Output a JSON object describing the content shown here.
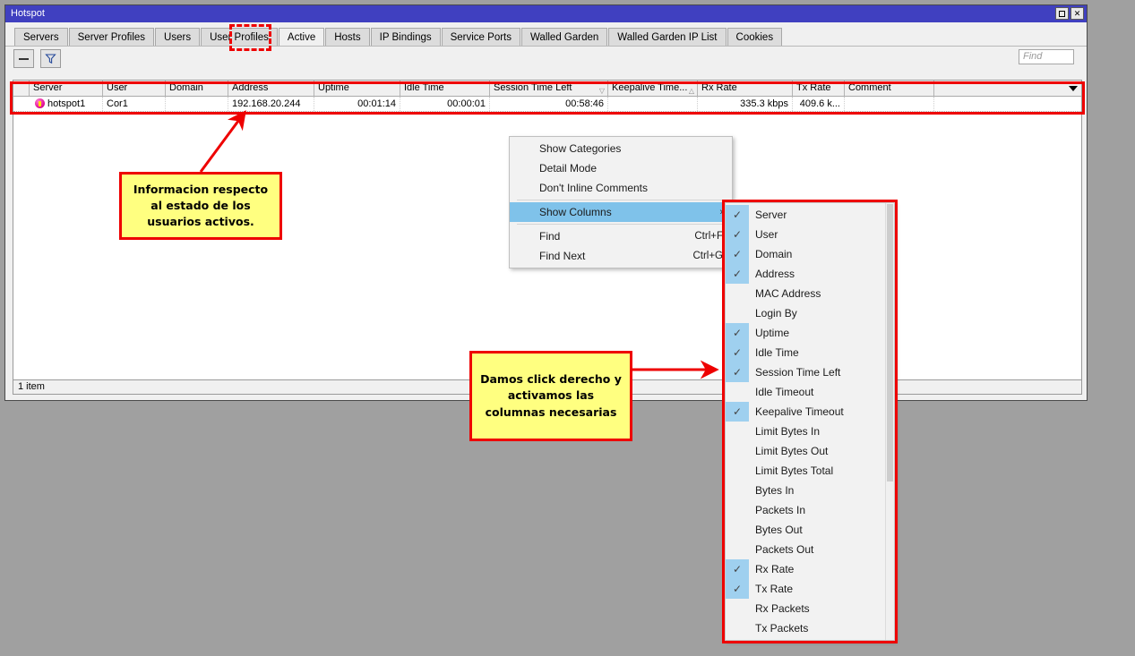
{
  "window": {
    "title": "Hotspot",
    "maximize_label": "maximize",
    "close_label": "✕"
  },
  "tabs": [
    {
      "label": "Servers",
      "active": false
    },
    {
      "label": "Server Profiles",
      "active": false
    },
    {
      "label": "Users",
      "active": false
    },
    {
      "label": "User Profiles",
      "active": false
    },
    {
      "label": "Active",
      "active": true
    },
    {
      "label": "Hosts",
      "active": false
    },
    {
      "label": "IP Bindings",
      "active": false
    },
    {
      "label": "Service Ports",
      "active": false
    },
    {
      "label": "Walled Garden",
      "active": false
    },
    {
      "label": "Walled Garden IP List",
      "active": false
    },
    {
      "label": "Cookies",
      "active": false
    }
  ],
  "toolbar": {
    "remove_label": "−",
    "filter_label": "filter",
    "find_placeholder": "Find"
  },
  "table": {
    "columns": [
      {
        "label": "",
        "width": 18,
        "align": "left",
        "sort": ""
      },
      {
        "label": "Server",
        "width": 82,
        "align": "left",
        "sort": ""
      },
      {
        "label": "User",
        "width": 70,
        "align": "left",
        "sort": ""
      },
      {
        "label": "Domain",
        "width": 70,
        "align": "left",
        "sort": ""
      },
      {
        "label": "Address",
        "width": 96,
        "align": "left",
        "sort": ""
      },
      {
        "label": "Uptime",
        "width": 96,
        "align": "right",
        "sort": ""
      },
      {
        "label": "Idle Time",
        "width": 100,
        "align": "right",
        "sort": ""
      },
      {
        "label": "Session Time Left",
        "width": 132,
        "align": "right",
        "sort": "▽"
      },
      {
        "label": "Keepalive Time...",
        "width": 100,
        "align": "right",
        "sort": "△"
      },
      {
        "label": "Rx Rate",
        "width": 106,
        "align": "right",
        "sort": ""
      },
      {
        "label": "Tx Rate",
        "width": 58,
        "align": "right",
        "sort": ""
      },
      {
        "label": "Comment",
        "width": 100,
        "align": "left",
        "sort": ""
      }
    ],
    "rows": [
      {
        "icon": "hotspot-icon",
        "server": "hotspot1",
        "user": "Cor1",
        "domain": "",
        "address": "192.168.20.244",
        "uptime": "00:01:14",
        "idle_time": "00:00:01",
        "session_time_left": "00:58:46",
        "keepalive_timeout": "",
        "rx_rate": "335.3 kbps",
        "tx_rate": "409.6 k...",
        "comment": ""
      }
    ]
  },
  "statusbar": {
    "text": "1 item"
  },
  "context_menu": {
    "items": [
      {
        "label": "Show Categories",
        "accel": "",
        "selected": false,
        "submenu": false
      },
      {
        "label": "Detail Mode",
        "accel": "",
        "selected": false,
        "submenu": false
      },
      {
        "label": "Don't Inline Comments",
        "accel": "",
        "selected": false,
        "submenu": false
      },
      {
        "separator": true
      },
      {
        "label": "Show Columns",
        "accel": "",
        "selected": true,
        "submenu": true
      },
      {
        "separator": true
      },
      {
        "label": "Find",
        "accel": "Ctrl+F",
        "selected": false,
        "submenu": false
      },
      {
        "label": "Find Next",
        "accel": "Ctrl+G",
        "selected": false,
        "submenu": false
      }
    ],
    "submenu_arrow": "›"
  },
  "columns_menu": {
    "check_glyph": "✓",
    "items": [
      {
        "label": "Server",
        "checked": true
      },
      {
        "label": "User",
        "checked": true
      },
      {
        "label": "Domain",
        "checked": true
      },
      {
        "label": "Address",
        "checked": true
      },
      {
        "label": "MAC Address",
        "checked": false
      },
      {
        "label": "Login By",
        "checked": false
      },
      {
        "label": "Uptime",
        "checked": true
      },
      {
        "label": "Idle Time",
        "checked": true
      },
      {
        "label": "Session Time Left",
        "checked": true
      },
      {
        "label": "Idle Timeout",
        "checked": false
      },
      {
        "label": "Keepalive Timeout",
        "checked": true
      },
      {
        "label": "Limit Bytes In",
        "checked": false
      },
      {
        "label": "Limit Bytes Out",
        "checked": false
      },
      {
        "label": "Limit Bytes Total",
        "checked": false
      },
      {
        "label": "Bytes In",
        "checked": false
      },
      {
        "label": "Packets In",
        "checked": false
      },
      {
        "label": "Bytes Out",
        "checked": false
      },
      {
        "label": "Packets Out",
        "checked": false
      },
      {
        "label": "Rx Rate",
        "checked": true
      },
      {
        "label": "Tx Rate",
        "checked": true
      },
      {
        "label": "Rx Packets",
        "checked": false
      },
      {
        "label": "Tx Packets",
        "checked": false
      }
    ]
  },
  "annotations": {
    "note1": "Informacion respecto al estado de los usuarios activos.",
    "note2": "Damos click derecho y activamos las columnas necesarias"
  },
  "colors": {
    "titlebar": "#4040c0",
    "highlight_red": "#ee0000",
    "note_yellow": "#ffff80",
    "menu_selected": "#7fc2ea",
    "check_highlight": "#9fd0ef"
  }
}
